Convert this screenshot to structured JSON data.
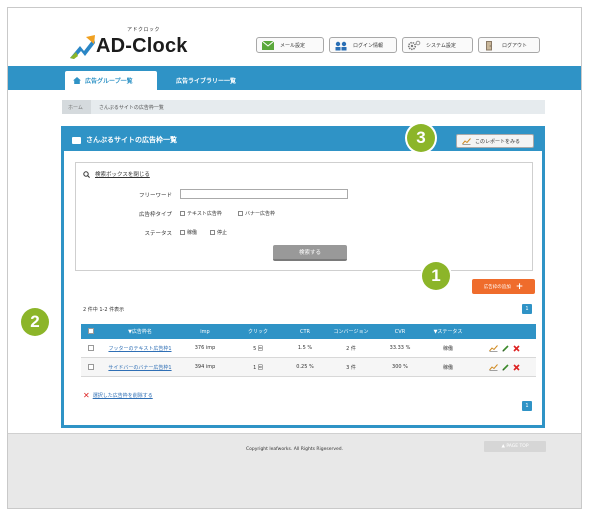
{
  "logo": {
    "ruby": "アドクロック",
    "name": "AD-Clock"
  },
  "header_buttons": [
    {
      "label": "メール設定",
      "icon": "mail-icon"
    },
    {
      "label": "ログイン情報",
      "icon": "users-icon"
    },
    {
      "label": "システム設定",
      "icon": "gear-icon"
    },
    {
      "label": "ログアウト",
      "icon": "logout-door-icon"
    }
  ],
  "nav": {
    "tabs": [
      {
        "label": "広告グループ一覧",
        "active": true,
        "icon": "home-icon"
      },
      {
        "label": "広告ライブラリー一覧",
        "active": false
      }
    ]
  },
  "breadcrumb": {
    "home": "ホーム",
    "current": "さんぷるサイトの広告枠一覧"
  },
  "panel": {
    "title": "さんぷるサイトの広告枠一覧",
    "report_button": "このレポートをみる",
    "search": {
      "toggle_label": "検索ボックスを閉じる",
      "keyword_label": "フリーワード",
      "keyword_value": "",
      "type_label": "広告枠タイプ",
      "type_options": [
        "テキスト広告枠",
        "バナー広告枠"
      ],
      "status_label": "ステータス",
      "status_options": [
        "稼働",
        "停止"
      ],
      "submit_label": "検索する"
    },
    "add_button": "広告枠の追加",
    "count_text": "2 件中 1-2 件表示",
    "page_number": "1",
    "table": {
      "headers": [
        "",
        "▼広告枠名",
        "imp",
        "クリック",
        "CTR",
        "コンバージョン",
        "CVR",
        "▼ステータス",
        ""
      ],
      "rows": [
        {
          "name": "フッターのテキスト広告枠1",
          "imp": "376 imp",
          "click": "5 回",
          "ctr": "1.5 %",
          "cv": "2 件",
          "cvr": "33.33 %",
          "status": "稼働"
        },
        {
          "name": "サイドバーのバナー広告枠1",
          "imp": "394 imp",
          "click": "1 回",
          "ctr": "0.25 %",
          "cv": "3 件",
          "cvr": "300 %",
          "status": "稼働"
        }
      ]
    },
    "delete_selected": "選択した広告枠を削除する"
  },
  "footer": {
    "copyright": "Copyright leafworks. All Rights Rigeserved.",
    "page_top": "▲ PAGE TOP"
  },
  "markers": [
    "1",
    "2",
    "3"
  ],
  "colors": {
    "primary": "#2f93c6",
    "accent": "#ef6c2c",
    "marker": "#8cb529"
  }
}
